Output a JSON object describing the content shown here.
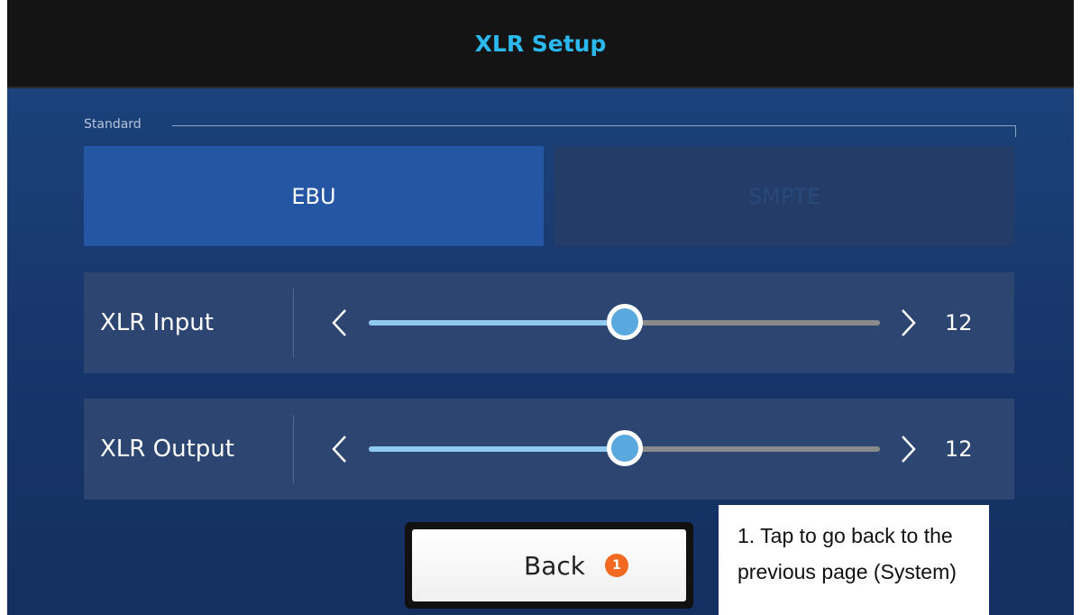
{
  "header": {
    "title": "XLR Setup"
  },
  "standard": {
    "label": "Standard",
    "options": [
      "EBU",
      "SMPTE"
    ],
    "selected": "EBU"
  },
  "sliders": [
    {
      "label": "XLR Input",
      "value": "12",
      "fill_fraction": 0.5
    },
    {
      "label": "XLR Output",
      "value": "12",
      "fill_fraction": 0.5
    }
  ],
  "back_button": {
    "label": "Back",
    "badge": "1"
  },
  "callout": {
    "text": "1. Tap to go back to the previous page (System)"
  },
  "colors": {
    "accent": "#2bb8ee",
    "selected_segment": "#2456a3",
    "badge": "#f26a21",
    "slider_fill": "#8fc9f0",
    "knob": "#5aa9de"
  },
  "icons": {
    "decrement": "chevron-left-icon",
    "increment": "chevron-right-icon"
  }
}
